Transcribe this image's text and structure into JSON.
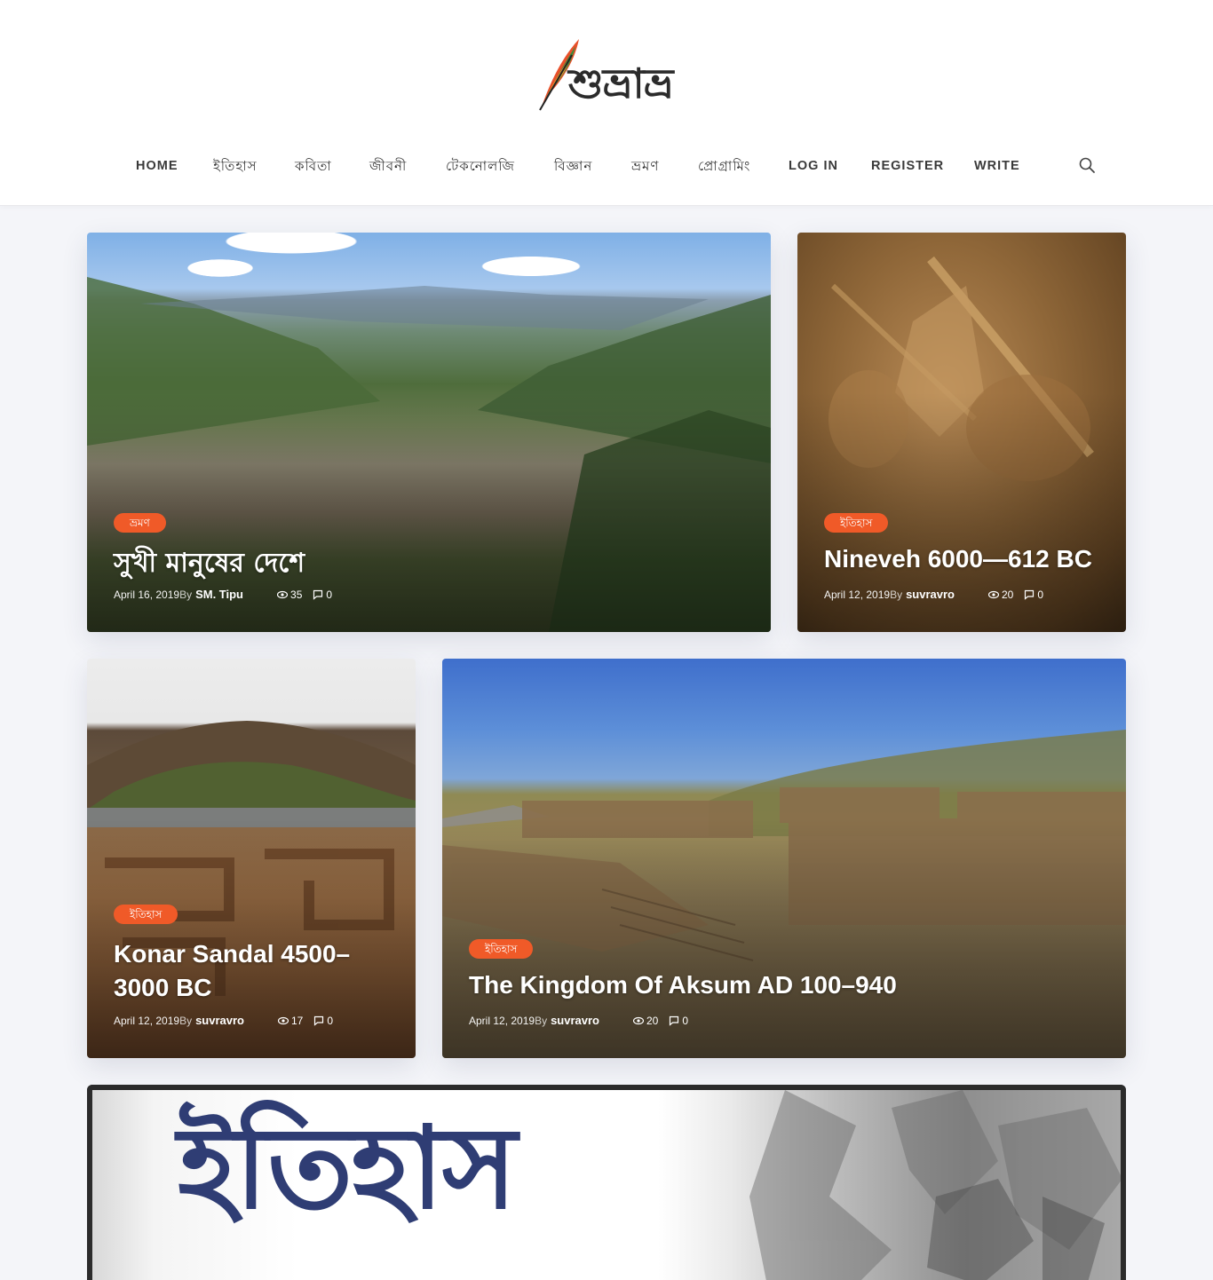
{
  "site": {
    "logo_text": "শুভ্রাভ্র"
  },
  "nav": {
    "items": [
      {
        "label": "HOME"
      },
      {
        "label": "ইতিহাস"
      },
      {
        "label": "কবিতা"
      },
      {
        "label": "জীবনী"
      },
      {
        "label": "টেকনোলজি"
      },
      {
        "label": "বিজ্ঞান"
      },
      {
        "label": "ভ্রমণ"
      },
      {
        "label": "প্রোগ্রামিং"
      },
      {
        "label": "LOG IN"
      },
      {
        "label": "REGISTER"
      },
      {
        "label": "WRITE"
      }
    ],
    "search_icon": "search-icon"
  },
  "posts": [
    {
      "category": "ভ্রমণ",
      "title": "সুখী মানুষের দেশে",
      "date": "April 16, 2019",
      "by": "By",
      "author": "SM. Tipu",
      "views": "35",
      "comments": "0"
    },
    {
      "category": "ইতিহাস",
      "title": "Nineveh 6000—612 BC",
      "date": "April 12, 2019",
      "by": "By",
      "author": "suvravro",
      "views": "20",
      "comments": "0"
    },
    {
      "category": "ইতিহাস",
      "title_line1": "Konar Sandal 4500–",
      "title_line2": "3000 BC",
      "date": "April 12, 2019",
      "by": "By",
      "author": "suvravro",
      "views": "17",
      "comments": "0"
    },
    {
      "category": "ইতিহাস",
      "title": "The Kingdom Of Aksum AD 100–940",
      "date": "April 12, 2019",
      "by": "By",
      "author": "suvravro",
      "views": "20",
      "comments": "0"
    }
  ],
  "banner": {
    "title": "ইতিহাস"
  },
  "colors": {
    "accent": "#f05a28",
    "banner_text": "#2f3d74",
    "page_bg": "#f4f5f9"
  }
}
